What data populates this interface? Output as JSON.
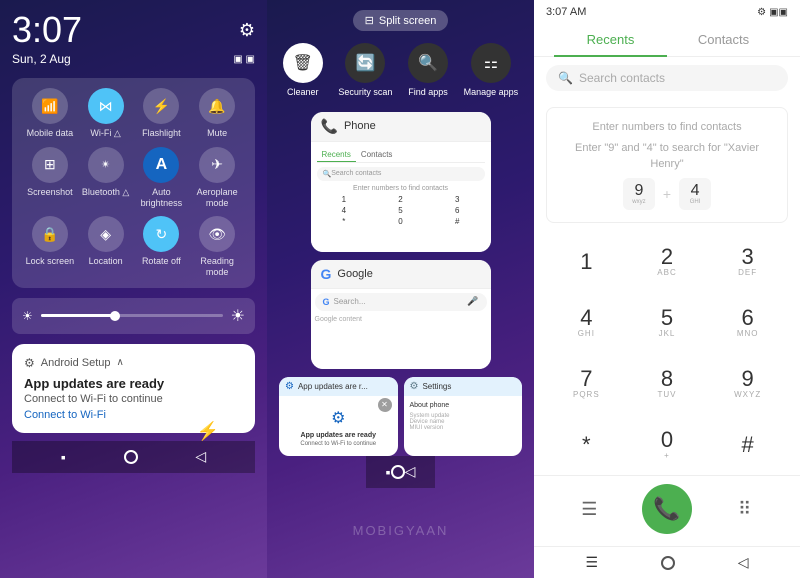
{
  "left": {
    "time": "3:07",
    "date": "Sun, 2 Aug",
    "gear_icon": "⚙",
    "toggles_row1": [
      {
        "label": "Mobile data",
        "icon": "📶",
        "active": false
      },
      {
        "label": "Wi-Fi",
        "icon": "📶",
        "active": true
      },
      {
        "label": "Flashlight",
        "icon": "🔦",
        "active": false
      },
      {
        "label": "Mute",
        "icon": "🔔",
        "active": false
      }
    ],
    "toggles_row2": [
      {
        "label": "Screenshot",
        "icon": "📷",
        "active": false
      },
      {
        "label": "Bluetooth △",
        "icon": "🔵",
        "active": false
      },
      {
        "label": "Auto brightness",
        "icon": "A",
        "active": true
      },
      {
        "label": "Aeroplane mode",
        "icon": "✈",
        "active": false
      }
    ],
    "toggles_row3": [
      {
        "label": "Lock screen",
        "icon": "🔒",
        "active": false
      },
      {
        "label": "Location",
        "icon": "📍",
        "active": false
      },
      {
        "label": "Rotate off",
        "icon": "🔄",
        "active": true
      },
      {
        "label": "Reading mode",
        "icon": "👁",
        "active": false
      }
    ],
    "notification": {
      "app": "Android Setup",
      "title": "App updates are ready",
      "subtitle": "Connect to Wi-Fi to continue",
      "link": "Connect to Wi-Fi"
    }
  },
  "middle": {
    "split_screen_label": "Split screen",
    "quick_actions": [
      {
        "label": "Cleaner",
        "icon": "🗑"
      },
      {
        "label": "Security scan",
        "icon": "🔄"
      },
      {
        "label": "Find apps",
        "icon": "🔍"
      },
      {
        "label": "Manage apps",
        "icon": "⚏"
      }
    ],
    "app_cards": [
      {
        "name": "Phone",
        "icon": "📞"
      },
      {
        "name": "Google",
        "icon": "G"
      }
    ],
    "bottom_cards": [
      {
        "name": "App updates are r...",
        "icon": "⚙"
      },
      {
        "name": "Settings",
        "icon": "⚙"
      }
    ],
    "watermark": "MOBIGYAAN"
  },
  "right": {
    "status_time": "3:07 AM",
    "status_gear": "⚙",
    "tabs": [
      {
        "label": "Recents",
        "active": true
      },
      {
        "label": "Contacts",
        "active": false
      }
    ],
    "search_placeholder": "Search contacts",
    "find_contacts": {
      "line1": "Enter numbers to find contacts",
      "line2": "Enter \"9\" and \"4\" to search for \"Xavier Henry\"",
      "num1": "9",
      "num1_sub": "wxyz",
      "num2": "4",
      "num2_sub": "GHI"
    },
    "numpad": [
      {
        "main": "1",
        "sub": ""
      },
      {
        "main": "2",
        "sub": "ABC"
      },
      {
        "main": "3",
        "sub": "DEF"
      },
      {
        "main": "4",
        "sub": "GHI"
      },
      {
        "main": "5",
        "sub": "JKL"
      },
      {
        "main": "6",
        "sub": "MNO"
      },
      {
        "main": "7",
        "sub": "PQRS"
      },
      {
        "main": "8",
        "sub": "TUV"
      },
      {
        "main": "9",
        "sub": "WXYZ"
      },
      {
        "main": "*",
        "sub": ""
      },
      {
        "main": "0",
        "sub": "+"
      },
      {
        "main": "#",
        "sub": ""
      }
    ],
    "dialer_icons": {
      "menu": "☰",
      "call": "📞",
      "keypad": "⠿"
    },
    "nav": {
      "menu": "☰",
      "home": "⬤",
      "back": "◁"
    }
  }
}
